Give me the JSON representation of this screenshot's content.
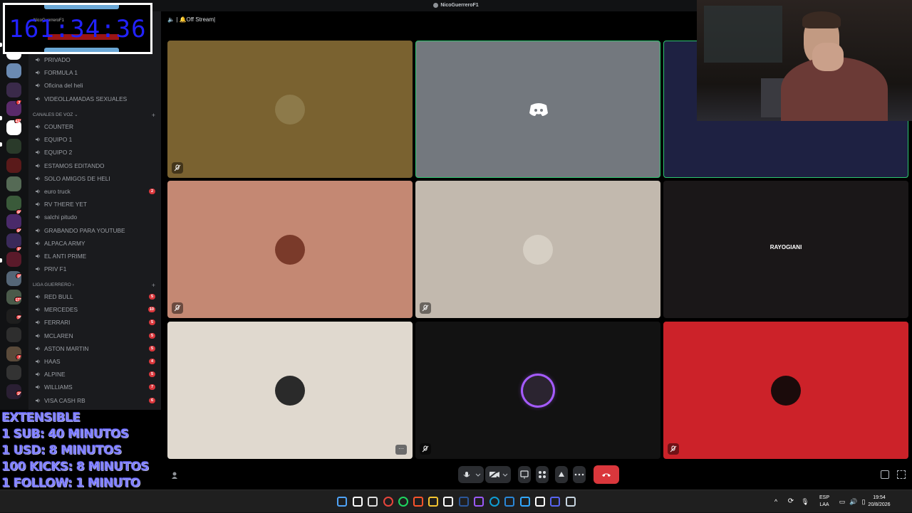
{
  "window": {
    "title": "NicoGuerreroF1"
  },
  "timer": {
    "value": "161:34:36",
    "subtext": "NicoGuerreroF1",
    "strip": "NUEVAS RENOVACIONES"
  },
  "overlay": {
    "lines": [
      "EXTENSIBLE",
      "1 SUB: 40 MINUTOS",
      "1 USD: 8 MINUTOS",
      "100 KICKS: 8 MINUTOS",
      "1 FOLLOW: 1 MINUTO"
    ]
  },
  "server_badges": [
    "3",
    "421",
    "60",
    "64",
    "33",
    "16",
    "173",
    "78",
    "7",
    "10"
  ],
  "channels": {
    "text_top": [
      {
        "name": "PRIVADO",
        "badge": ""
      },
      {
        "name": "FORMULA 1",
        "badge": ""
      },
      {
        "name": "Oficina del heli",
        "badge": ""
      },
      {
        "name": "VIDEOLLAMADAS SEXUALES",
        "badge": ""
      }
    ],
    "voice_category": "CANALES DE VOZ",
    "voice": [
      {
        "name": "COUNTER",
        "badge": ""
      },
      {
        "name": "EQUIPO 1",
        "badge": ""
      },
      {
        "name": "EQUIPO 2",
        "badge": ""
      },
      {
        "name": "ESTAMOS EDITANDO",
        "badge": ""
      },
      {
        "name": "SOLO AMIGOS DE HELI",
        "badge": ""
      },
      {
        "name": "euro truck",
        "badge": "2"
      },
      {
        "name": "RV THERE YET",
        "badge": ""
      },
      {
        "name": "salchi pitudo",
        "badge": ""
      },
      {
        "name": "GRABANDO PARA YOUTUBE",
        "badge": ""
      },
      {
        "name": "ALPACA ARMY",
        "badge": ""
      },
      {
        "name": "EL ANTI PRIME",
        "badge": ""
      },
      {
        "name": "PRIV F1",
        "badge": ""
      }
    ],
    "league_category": "LIGA GUERRERO",
    "league": [
      {
        "name": "RED BULL",
        "badge": "5"
      },
      {
        "name": "MERCEDES",
        "badge": "10"
      },
      {
        "name": "FERRARI",
        "badge": "5"
      },
      {
        "name": "MCLAREN",
        "badge": "5"
      },
      {
        "name": "ASTON MARTIN",
        "badge": "5"
      },
      {
        "name": "HAAS",
        "badge": "4"
      },
      {
        "name": "ALPINE",
        "badge": "5"
      },
      {
        "name": "WILLIAMS",
        "badge": "7"
      },
      {
        "name": "VISA CASH RB",
        "badge": "6"
      }
    ]
  },
  "call": {
    "channel_name": "| 🔔Off Stream|",
    "tiles": [
      {
        "bg": "#7a6230",
        "avatar": "#8d7a4a",
        "muted": true,
        "label": ""
      },
      {
        "bg": "#73787e",
        "avatar": "",
        "muted": false,
        "label": ""
      },
      {
        "bg": "#1e2142",
        "avatar": "",
        "muted": false,
        "label": ""
      },
      {
        "bg": "#c48873",
        "avatar": "#7a3a2a",
        "muted": true,
        "label": ""
      },
      {
        "bg": "#c2b9ae",
        "avatar": "#d6cfc4",
        "muted": true,
        "label": ""
      },
      {
        "bg": "#1a1718",
        "avatar": "",
        "muted": false,
        "label": "RAYOGIANI"
      },
      {
        "bg": "#e0d9cf",
        "avatar": "#2a2a2a",
        "muted": false,
        "label": ""
      },
      {
        "bg": "#121212",
        "avatar": "#2b2430",
        "muted": true,
        "label": ""
      },
      {
        "bg": "#cc2229",
        "avatar": "#1b0b0b",
        "muted": true,
        "label": ""
      }
    ]
  },
  "taskbar": {
    "lang": "ESP",
    "lang2": "LAA",
    "time": "19:54",
    "date": "20/8/2026"
  }
}
